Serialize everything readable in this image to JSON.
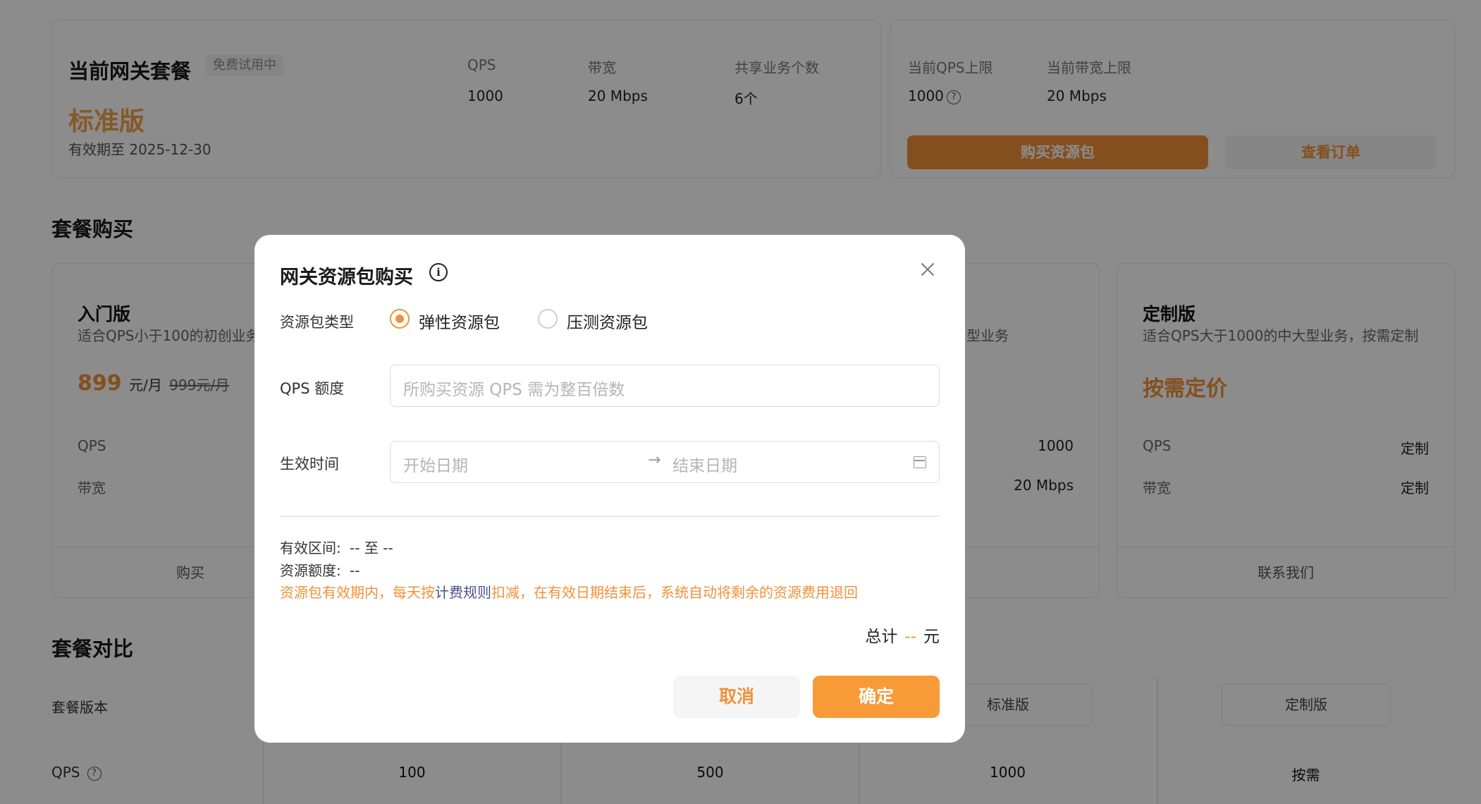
{
  "current_plan": {
    "title": "当前网关套餐",
    "badge": "免费试用中",
    "edition": "标准版",
    "valid_until": "有效期至 2025-12-30",
    "stats": [
      {
        "label": "QPS",
        "value": "1000"
      },
      {
        "label": "带宽",
        "value": "20 Mbps"
      },
      {
        "label": "共享业务个数",
        "value": "6个"
      }
    ]
  },
  "limits": {
    "qps_label": "当前QPS上限",
    "qps_value": "1000",
    "bw_label": "当前带宽上限",
    "bw_value": "20 Mbps",
    "buy_button": "购买资源包",
    "orders_button": "查看订单"
  },
  "purchase_section": {
    "title": "套餐购买",
    "plans": [
      {
        "name": "入门版",
        "desc": "适合QPS小于100的初创业务",
        "price": "899",
        "unit": "元/月",
        "old_price": "999元/月",
        "qps_label": "QPS",
        "bw_label": "带宽",
        "action": "购买"
      },
      {
        "desc": "型业务",
        "qps_value": "1000",
        "bw_value": "20 Mbps"
      },
      {
        "name": "定制版",
        "desc": "适合QPS大于1000的中大型业务，按需定制",
        "price": "按需定价",
        "qps_label": "QPS",
        "qps_value": "定制",
        "bw_label": "带宽",
        "bw_value": "定制",
        "action": "联系我们"
      }
    ]
  },
  "compare_section": {
    "title": "套餐对比",
    "version_label": "套餐版本",
    "qps_label": "QPS",
    "columns": [
      "标准版",
      "定制版"
    ],
    "qps_values": [
      "100",
      "500",
      "1000",
      "按需"
    ]
  },
  "modal": {
    "title": "网关资源包购买",
    "type_label": "资源包类型",
    "options": [
      "弹性资源包",
      "压测资源包"
    ],
    "selected_option": "弹性资源包",
    "qps_label": "QPS 额度",
    "qps_placeholder": "所购买资源 QPS 需为整百倍数",
    "time_label": "生效时间",
    "start_placeholder": "开始日期",
    "end_placeholder": "结束日期",
    "range_label": "有效区间:",
    "range_value": "-- 至 --",
    "quota_label": "资源额度:",
    "quota_value": "--",
    "notice_prefix": "资源包有效期内，每天按",
    "notice_link": "计费规则",
    "notice_suffix": "扣减，在有效日期结束后，系统自动将剩余的资源费用退回",
    "total_label": "总计",
    "total_amount": "--",
    "total_unit": "元",
    "cancel": "取消",
    "confirm": "确定"
  },
  "colors": {
    "accent": "#f0913a",
    "link": "#4a4f8c",
    "overlay": "rgba(0,0,0,0.45)"
  }
}
